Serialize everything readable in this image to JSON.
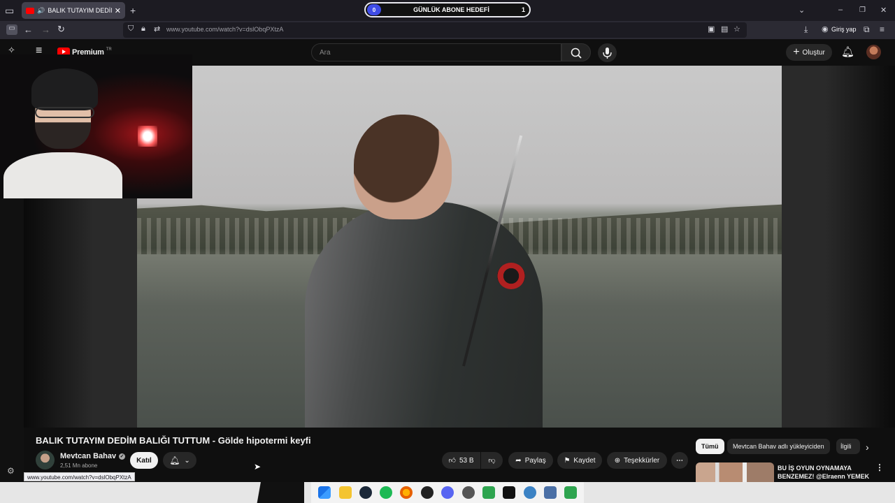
{
  "browser": {
    "tab_title": "BALIK TUTAYIM DEDİM BALI",
    "url": "www.youtube.com/watch?v=dslObqPXtzA",
    "sign_in": "Giriş yap",
    "status_url": "www.youtube.com/watch?v=dslObqPXtzA"
  },
  "overlay_goal": {
    "title": "GÜNLÜK ABONE HEDEFİ",
    "current": "0",
    "target": "1"
  },
  "youtube": {
    "logo": "Premium",
    "logo_region": "TR",
    "search_placeholder": "Ara",
    "create_label": "Oluştur"
  },
  "video": {
    "title": "BALIK TUTAYIM DEDİM BALIĞI TUTTUM - Gölde hipotermi keyfi",
    "channel_name": "Mevtcan Bahav",
    "subscribers": "2,51 Mn abone",
    "join_label": "Katıl",
    "like_count": "53 B",
    "share_label": "Paylaş",
    "save_label": "Kaydet",
    "thanks_label": "Teşekkürler"
  },
  "right_column": {
    "chips": [
      "Tümü",
      "Mevtcan Bahav adlı yükleyiciden",
      "İlgili"
    ],
    "suggestion_title_line1": "BU İŞ OYUN OYNAMAYA",
    "suggestion_title_line2": "BENZEMEZ! @Elraenn YEMEK ..."
  },
  "icons": [
    "tab-list-icon",
    "speaker-icon",
    "close-icon",
    "plus-icon",
    "chevron-down-icon",
    "minimize-icon",
    "restore-icon",
    "window-close-icon",
    "sidebar-icon",
    "back-icon",
    "forward-icon",
    "reload-icon",
    "shield-icon",
    "lock-icon",
    "permissions-icon",
    "download-icon",
    "account-icon",
    "extensions-icon",
    "menu-icon",
    "hamburger-icon",
    "search-icon",
    "mic-icon",
    "bell-icon",
    "like-icon",
    "dislike-icon",
    "share-icon",
    "bookmark-icon",
    "thanks-icon",
    "more-icon",
    "settings-icon"
  ],
  "colors": {
    "youtube_red": "#ff0000",
    "background": "#0f0f0f",
    "goal_accent": "#3f4ce6"
  }
}
